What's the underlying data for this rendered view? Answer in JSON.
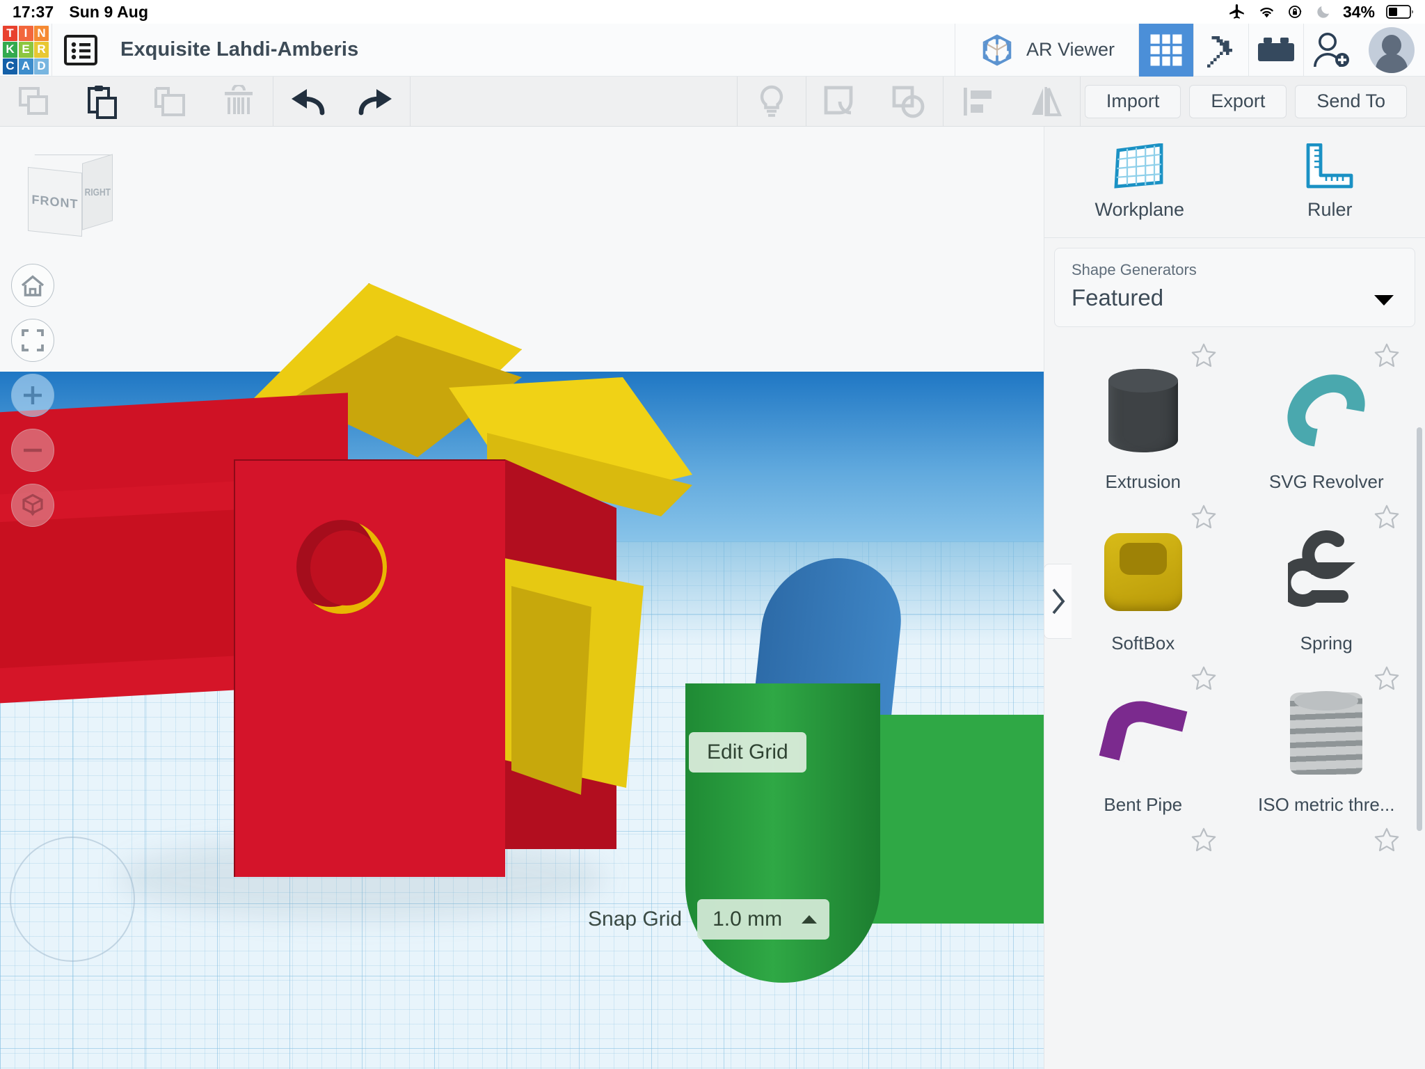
{
  "status_bar": {
    "time": "17:37",
    "date": "Sun 9 Aug",
    "battery_percent": "34%",
    "icons": [
      "airplane-mode-icon",
      "wifi-icon",
      "rotation-lock-icon",
      "do-not-disturb-icon",
      "battery-icon"
    ]
  },
  "header": {
    "logo_letters": [
      "T",
      "I",
      "N",
      "K",
      "E",
      "R",
      "C",
      "A",
      "D"
    ],
    "logo_colors": [
      "#e8412e",
      "#f2663c",
      "#f58a33",
      "#33aa4e",
      "#8cc63f",
      "#e8c832",
      "#1460a8",
      "#3d8dcc",
      "#79b6e0"
    ],
    "list_icon": "list-icon",
    "document_title": "Exquisite Lahdi-Amberis",
    "ar_viewer_label": "AR Viewer",
    "ar_viewer_icon": "ar-cube-icon",
    "tabs": [
      {
        "name": "shapes-grid-tab",
        "icon": "grid-icon",
        "active": true
      },
      {
        "name": "minecraft-tab",
        "icon": "pickaxe-icon",
        "active": false
      },
      {
        "name": "bricks-tab",
        "icon": "lego-brick-icon",
        "active": false
      }
    ],
    "invite_icon": "add-person-icon",
    "avatar": "user-avatar"
  },
  "toolbar": {
    "left_tools": [
      {
        "name": "copy-button",
        "icon": "copy-icon",
        "enabled": false
      },
      {
        "name": "paste-button",
        "icon": "clipboard-paste-icon",
        "enabled": true
      },
      {
        "name": "duplicate-button",
        "icon": "duplicate-icon",
        "enabled": false
      },
      {
        "name": "delete-button",
        "icon": "trash-icon",
        "enabled": false
      }
    ],
    "history_tools": [
      {
        "name": "undo-button",
        "icon": "undo-arrow-icon",
        "enabled": true
      },
      {
        "name": "redo-button",
        "icon": "redo-arrow-icon",
        "enabled": true
      }
    ],
    "right_tools": [
      {
        "name": "hint-button",
        "icon": "lightbulb-icon",
        "enabled": false
      },
      {
        "name": "group-button",
        "icon": "group-shapes-icon",
        "enabled": false
      },
      {
        "name": "ungroup-button",
        "icon": "ungroup-shapes-icon",
        "enabled": false
      },
      {
        "name": "align-button",
        "icon": "align-icon",
        "enabled": false
      },
      {
        "name": "mirror-button",
        "icon": "mirror-icon",
        "enabled": false
      }
    ],
    "import_label": "Import",
    "export_label": "Export",
    "send_to_label": "Send To"
  },
  "canvas": {
    "view_cube": {
      "front_label": "FRONT",
      "right_label": "RIGHT"
    },
    "nav_buttons": [
      {
        "name": "home-view-button",
        "icon": "home-icon"
      },
      {
        "name": "fit-to-view-button",
        "icon": "fit-frame-icon"
      },
      {
        "name": "zoom-in-button",
        "icon": "plus-icon"
      },
      {
        "name": "zoom-out-button",
        "icon": "minus-icon"
      },
      {
        "name": "perspective-toggle-button",
        "icon": "ortho-cube-icon"
      }
    ],
    "edit_grid_label": "Edit Grid",
    "snap_grid_label": "Snap Grid",
    "snap_grid_value": "1.0 mm",
    "flyout_icon": "chevron-right-icon"
  },
  "panel": {
    "tools": [
      {
        "label": "Workplane",
        "icon": "workplane-icon"
      },
      {
        "label": "Ruler",
        "icon": "ruler-icon"
      }
    ],
    "generator_label": "Shape Generators",
    "generator_value": "Featured",
    "shapes": [
      {
        "name": "Extrusion",
        "thumb": "extrusion",
        "favorite": false
      },
      {
        "name": "SVG Revolver",
        "thumb": "svgrev",
        "favorite": false
      },
      {
        "name": "SoftBox",
        "thumb": "softbox",
        "favorite": false
      },
      {
        "name": "Spring",
        "thumb": "spring",
        "favorite": false
      },
      {
        "name": "Bent Pipe",
        "thumb": "bentpipe",
        "favorite": false
      },
      {
        "name": "ISO metric thre...",
        "thumb": "iso",
        "favorite": false
      }
    ]
  }
}
